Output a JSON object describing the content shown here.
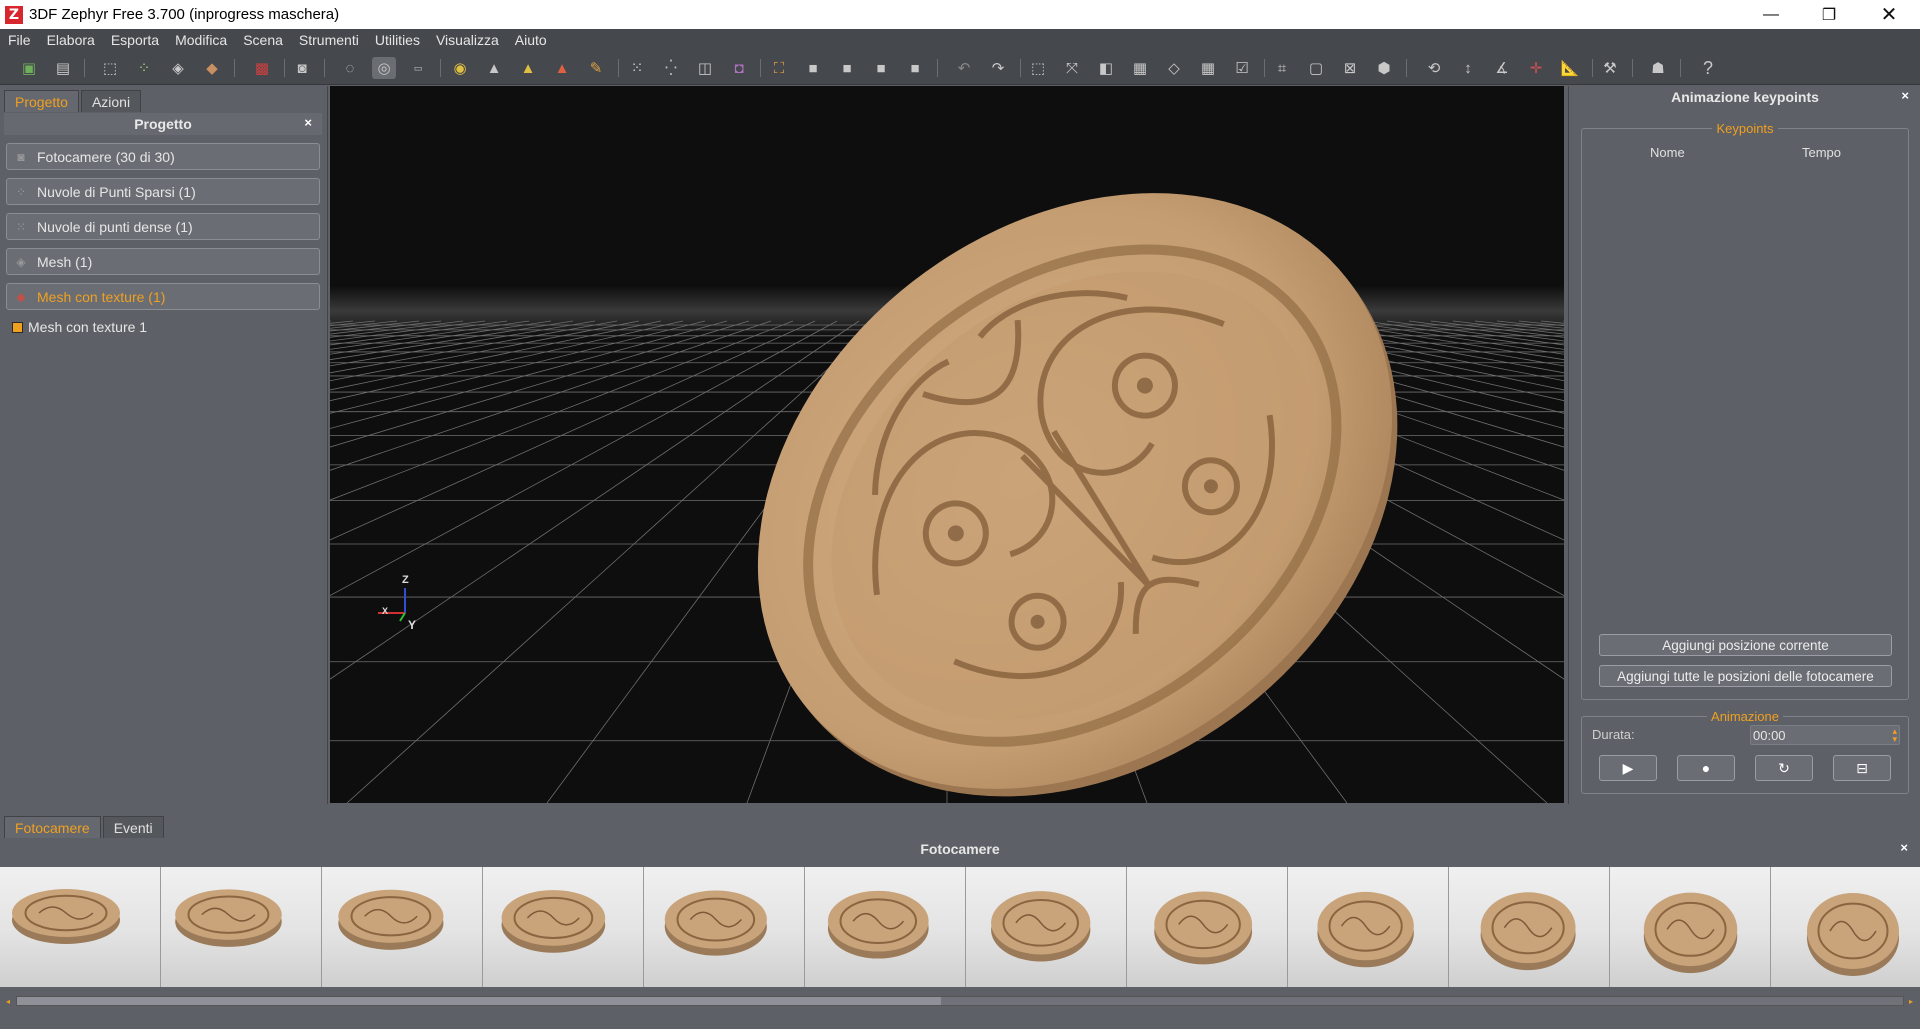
{
  "window": {
    "title": "3DF Zephyr Free 3.700 (inprogress maschera)",
    "logo_letter": "Z",
    "controls": {
      "minimize": "—",
      "maximize": "❐",
      "close": "✕"
    }
  },
  "menubar": [
    "File",
    "Elabora",
    "Esporta",
    "Modifica",
    "Scena",
    "Strumenti",
    "Utilities",
    "Visualizza",
    "Aiuto"
  ],
  "toolbar": {
    "help_label": "?"
  },
  "left_panel": {
    "tabs": [
      {
        "label": "Progetto",
        "active": true
      },
      {
        "label": "Azioni",
        "active": false
      }
    ],
    "header": "Progetto",
    "close_glyph": "×",
    "rows": [
      {
        "label": "Fotocamere (30 di 30)",
        "icon": "camera-icon",
        "highlight": false
      },
      {
        "label": "Nuvole di Punti Sparsi (1)",
        "icon": "sparse-cloud-icon",
        "highlight": false
      },
      {
        "label": "Nuvole di punti dense (1)",
        "icon": "dense-cloud-icon",
        "highlight": false
      },
      {
        "label": "Mesh (1)",
        "icon": "mesh-icon",
        "highlight": false
      },
      {
        "label": "Mesh con texture (1)",
        "icon": "textured-mesh-icon",
        "highlight": true
      }
    ],
    "tree_item": "Mesh con texture 1"
  },
  "viewport": {
    "axes": {
      "z": "Z",
      "x": "X",
      "y": "Y"
    }
  },
  "right_panel": {
    "header": "Animazione keypoints",
    "close_glyph": "×",
    "keypoints_group": "Keypoints",
    "columns": [
      "Nome",
      "Tempo"
    ],
    "buttons": {
      "add_current": "Aggiungi posizione corrente",
      "add_all_cameras": "Aggiungi tutte le posizioni delle fotocamere"
    },
    "animation_group": "Animazione",
    "duration_label": "Durata:",
    "duration_value": "00:00",
    "anim_controls": {
      "play": "▶",
      "record": "●",
      "loop": "↻",
      "save": "⊟"
    }
  },
  "bottom": {
    "tabs": [
      {
        "label": "Fotocamere",
        "active": true
      },
      {
        "label": "Eventi",
        "active": false
      }
    ],
    "header": "Fotocamere",
    "close_glyph": "×",
    "thumbnail_count": 12,
    "scroll_left": "◂",
    "scroll_right": "▸"
  },
  "colors": {
    "accent": "#f0a020",
    "panel": "#5d6066",
    "toolbar": "#45484d",
    "viewport_bg": "#0e0e0e",
    "model": "#c9a37a"
  }
}
